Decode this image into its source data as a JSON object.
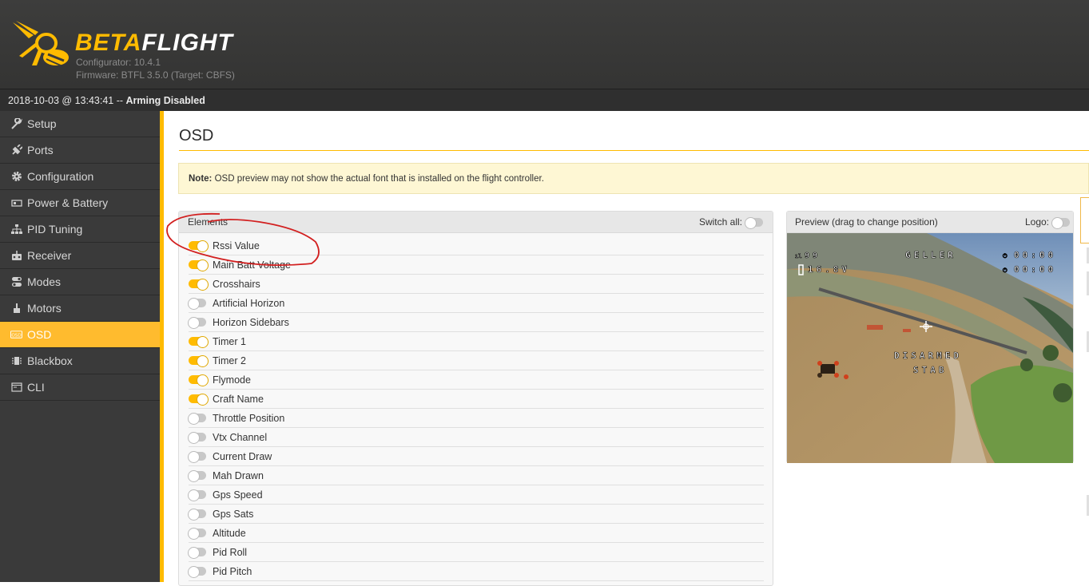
{
  "header": {
    "brand_beta": "BETA",
    "brand_flight": "FLIGHT",
    "configurator": "Configurator: 10.4.1",
    "firmware": "Firmware: BTFL 3.5.0 (Target: CBFS)"
  },
  "status": {
    "datetime": "2018-10-03 @ 13:43:41 -- ",
    "arming": "Arming Disabled"
  },
  "sidebar": {
    "items": [
      {
        "label": "Setup",
        "icon": "wrench-icon"
      },
      {
        "label": "Ports",
        "icon": "plug-icon"
      },
      {
        "label": "Configuration",
        "icon": "gear-icon"
      },
      {
        "label": "Power & Battery",
        "icon": "battery-icon"
      },
      {
        "label": "PID Tuning",
        "icon": "sitemap-icon"
      },
      {
        "label": "Receiver",
        "icon": "receiver-icon"
      },
      {
        "label": "Modes",
        "icon": "toggle-icon"
      },
      {
        "label": "Motors",
        "icon": "motor-icon"
      },
      {
        "label": "OSD",
        "icon": "osd-icon",
        "active": true
      },
      {
        "label": "Blackbox",
        "icon": "blackbox-icon"
      },
      {
        "label": "CLI",
        "icon": "terminal-icon"
      }
    ]
  },
  "main": {
    "title": "OSD",
    "note_bold": "Note:",
    "note_text": " OSD preview may not show the actual font that is installed on the flight controller."
  },
  "elements": {
    "header": "Elements",
    "switch_all_label": "Switch all:",
    "items": [
      {
        "label": "Rssi Value",
        "on": true
      },
      {
        "label": "Main Batt Voltage",
        "on": true
      },
      {
        "label": "Crosshairs",
        "on": true
      },
      {
        "label": "Artificial Horizon",
        "on": false
      },
      {
        "label": "Horizon Sidebars",
        "on": false
      },
      {
        "label": "Timer 1",
        "on": true
      },
      {
        "label": "Timer 2",
        "on": true
      },
      {
        "label": "Flymode",
        "on": true
      },
      {
        "label": "Craft Name",
        "on": true
      },
      {
        "label": "Throttle Position",
        "on": false
      },
      {
        "label": "Vtx Channel",
        "on": false
      },
      {
        "label": "Current Draw",
        "on": false
      },
      {
        "label": "Mah Drawn",
        "on": false
      },
      {
        "label": "Gps Speed",
        "on": false
      },
      {
        "label": "Gps Sats",
        "on": false
      },
      {
        "label": "Altitude",
        "on": false
      },
      {
        "label": "Pid Roll",
        "on": false
      },
      {
        "label": "Pid Pitch",
        "on": false
      }
    ]
  },
  "preview": {
    "header": "Preview (drag to change position)",
    "logo_label": "Logo:",
    "osd": {
      "rssi": "99",
      "craft_name": "GELLER",
      "timer1": "00:00",
      "timer2": "00:00",
      "voltage": "16.8V",
      "disarmed": "DISARMED",
      "flymode": "STAB"
    }
  },
  "colors": {
    "accent": "#ffbb00",
    "header_bg": "#3b3b3a",
    "sidebar_bg": "#3a3a3a"
  }
}
